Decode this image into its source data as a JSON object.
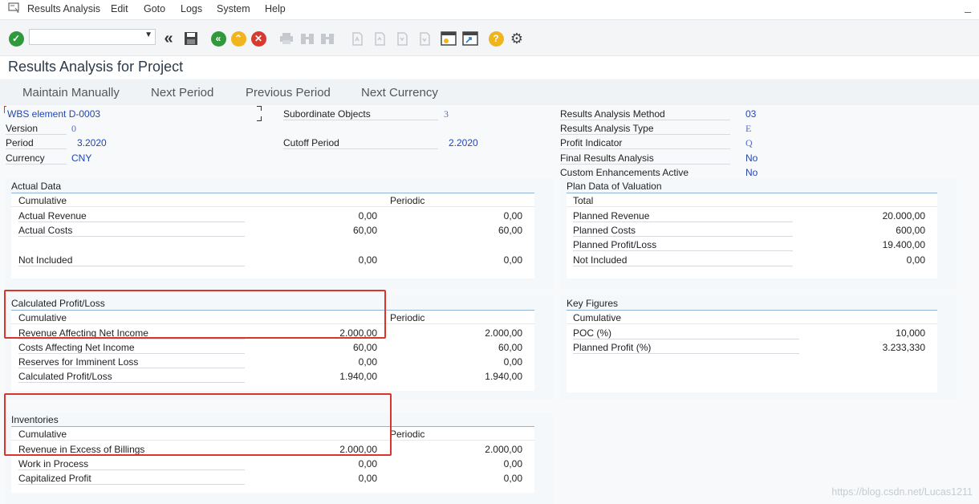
{
  "menu": [
    "Results Analysis",
    "Edit",
    "Goto",
    "Logs",
    "System",
    "Help"
  ],
  "window": {
    "minimize": "_"
  },
  "toolbar": {
    "command_value": "",
    "icons": [
      "check-icon",
      "back-double-icon",
      "save-icon",
      "back-icon",
      "exit-icon",
      "cancel-icon",
      "print-icon",
      "find-icon",
      "find-next-icon",
      "first-page-icon",
      "prev-page-icon",
      "next-page-icon",
      "last-page-icon",
      "new-session-icon",
      "shortcut-icon",
      "help-icon",
      "settings-icon"
    ],
    "colors": {
      "green": "#2e9a3c",
      "yellow": "#f0b41c",
      "red": "#d73a2e",
      "gray": "#c5c9ce"
    }
  },
  "title": "Results Analysis for Project",
  "actions": [
    "Maintain Manually",
    "Next Period",
    "Previous Period",
    "Next Currency"
  ],
  "header": {
    "wbs_element": "WBS element D-0003",
    "version_label": "Version",
    "version_value": "0",
    "period_label": "Period",
    "period_value": "3.2020",
    "currency_label": "Currency",
    "currency_value": "CNY",
    "subordinate_label": "Subordinate Objects",
    "subordinate_value": "3",
    "cutoff_label": "Cutoff Period",
    "cutoff_value": "2.2020",
    "ra_method_label": "Results Analysis Method",
    "ra_method_value": "03",
    "ra_type_label": "Results Analysis Type",
    "ra_type_value": "E",
    "profit_ind_label": "Profit Indicator",
    "profit_ind_value": "Q",
    "final_ra_label": "Final Results Analysis",
    "final_ra_value": "No",
    "custom_enh_label": "Custom Enhancements Active",
    "custom_enh_value": "No"
  },
  "actual": {
    "title": "Actual Data",
    "col1": "Cumulative",
    "col2": "Periodic",
    "rows": [
      {
        "label": "Actual Revenue",
        "cum": "0,00",
        "per": "0,00"
      },
      {
        "label": "Actual Costs",
        "cum": "60,00",
        "per": "60,00"
      },
      {
        "label": "Not Included",
        "cum": "0,00",
        "per": "0,00"
      }
    ]
  },
  "plan": {
    "title": "Plan Data of Valuation",
    "col1": "Total",
    "rows": [
      {
        "label": "Planned Revenue",
        "val": "20.000,00"
      },
      {
        "label": "Planned Costs",
        "val": "600,00"
      },
      {
        "label": "Planned Profit/Loss",
        "val": "19.400,00"
      },
      {
        "label": "Not Included",
        "val": "0,00"
      }
    ]
  },
  "calc": {
    "title": "Calculated Profit/Loss",
    "col1": "Cumulative",
    "col2": "Periodic",
    "rows": [
      {
        "label": "Revenue Affecting Net Income",
        "cum": "2.000,00",
        "per": "2.000,00"
      },
      {
        "label": "Costs Affecting Net Income",
        "cum": "60,00",
        "per": "60,00"
      },
      {
        "label": "Reserves for Imminent Loss",
        "cum": "0,00",
        "per": "0,00"
      },
      {
        "label": "Calculated Profit/Loss",
        "cum": "1.940,00",
        "per": "1.940,00"
      }
    ]
  },
  "keyfig": {
    "title": "Key Figures",
    "col1": "Cumulative",
    "rows": [
      {
        "label": "POC (%)",
        "val": "10,000"
      },
      {
        "label": "Planned Profit (%)",
        "val": "3.233,330"
      }
    ]
  },
  "inv": {
    "title": "Inventories",
    "col1": "Cumulative",
    "col2": "Periodic",
    "rows": [
      {
        "label": "Revenue in Excess of Billings",
        "cum": "2.000,00",
        "per": "2.000,00"
      },
      {
        "label": "Work in Process",
        "cum": "0,00",
        "per": "0,00"
      },
      {
        "label": "Capitalized Profit",
        "cum": "0,00",
        "per": "0,00"
      }
    ]
  },
  "watermark": "https://blog.csdn.net/Lucas1211"
}
